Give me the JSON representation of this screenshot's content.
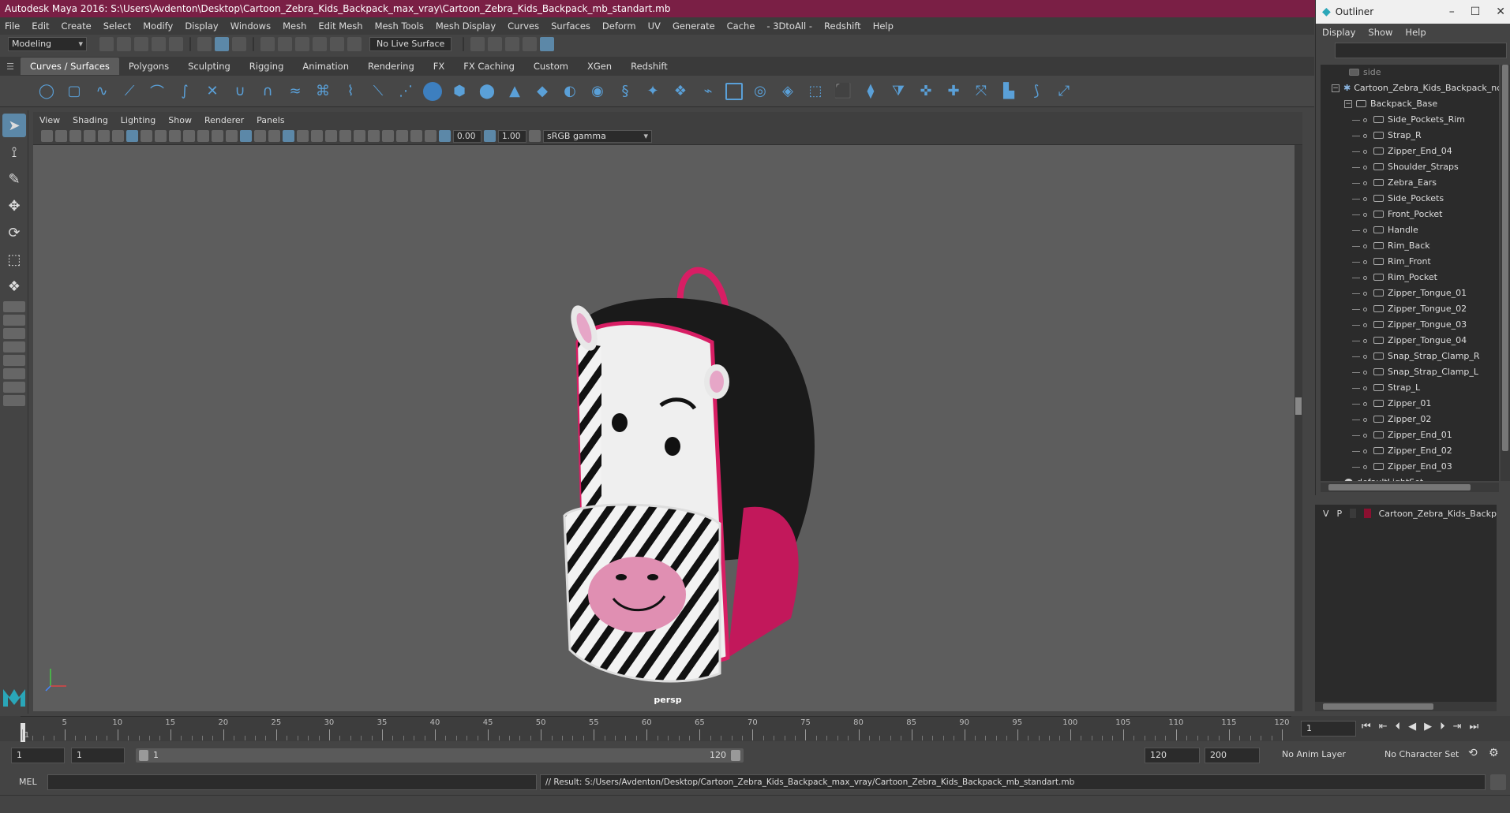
{
  "window": {
    "title": "Autodesk Maya 2016: S:\\Users\\Avdenton\\Desktop\\Cartoon_Zebra_Kids_Backpack_max_vray\\Cartoon_Zebra_Kids_Backpack_mb_standart.mb"
  },
  "menubar": [
    "File",
    "Edit",
    "Create",
    "Select",
    "Modify",
    "Display",
    "Windows",
    "Mesh",
    "Edit Mesh",
    "Mesh Tools",
    "Mesh Display",
    "Curves",
    "Surfaces",
    "Deform",
    "UV",
    "Generate",
    "Cache",
    "- 3DtoAll -",
    "Redshift",
    "Help"
  ],
  "statusline": {
    "mode": "Modeling",
    "live_surface": "No Live Surface"
  },
  "shelf": {
    "tabs": [
      "Curves / Surfaces",
      "Polygons",
      "Sculpting",
      "Rigging",
      "Animation",
      "Rendering",
      "FX",
      "FX Caching",
      "Custom",
      "XGen",
      "Redshift"
    ],
    "active_tab": "Curves / Surfaces"
  },
  "viewport": {
    "menu": [
      "View",
      "Shading",
      "Lighting",
      "Show",
      "Renderer",
      "Panels"
    ],
    "exposure": "0.00",
    "gamma": "1.00",
    "color_space": "sRGB gamma",
    "camera": "persp"
  },
  "outliner": {
    "title": "Outliner",
    "menu": [
      "Display",
      "Show",
      "Help"
    ],
    "side_label": "side",
    "root": "Cartoon_Zebra_Kids_Backpack_nc",
    "group": "Backpack_Base",
    "items": [
      "Side_Pockets_Rim",
      "Strap_R",
      "Zipper_End_04",
      "Shoulder_Straps",
      "Zebra_Ears",
      "Side_Pockets",
      "Front_Pocket",
      "Handle",
      "Rim_Back",
      "Rim_Front",
      "Rim_Pocket",
      "Zipper_Tongue_01",
      "Zipper_Tongue_02",
      "Zipper_Tongue_03",
      "Zipper_Tongue_04",
      "Snap_Strap_Clamp_R",
      "Snap_Strap_Clamp_L",
      "Strap_L",
      "Zipper_01",
      "Zipper_02",
      "Zipper_End_01",
      "Zipper_End_02",
      "Zipper_End_03"
    ],
    "tail": "defaultLightSet"
  },
  "layers": {
    "v": "V",
    "p": "P",
    "name": "Cartoon_Zebra_Kids_Backp",
    "color": "#8b1030"
  },
  "timeline": {
    "ticks": [
      "1",
      "5",
      "10",
      "15",
      "20",
      "25",
      "30",
      "35",
      "40",
      "45",
      "50",
      "55",
      "60",
      "65",
      "70",
      "75",
      "80",
      "85",
      "90",
      "95",
      "100",
      "105",
      "110",
      "115",
      "120"
    ],
    "current_frame": "1",
    "playback_start": "1",
    "start": "1",
    "range_start": "1",
    "range_end": "120",
    "end": "120",
    "anim_end": "200",
    "anim_layer": "No Anim Layer",
    "character_set": "No Character Set"
  },
  "command": {
    "lang": "MEL",
    "result": "// Result: S:/Users/Avdenton/Desktop/Cartoon_Zebra_Kids_Backpack_max_vray/Cartoon_Zebra_Kids_Backpack_mb_standart.mb"
  }
}
